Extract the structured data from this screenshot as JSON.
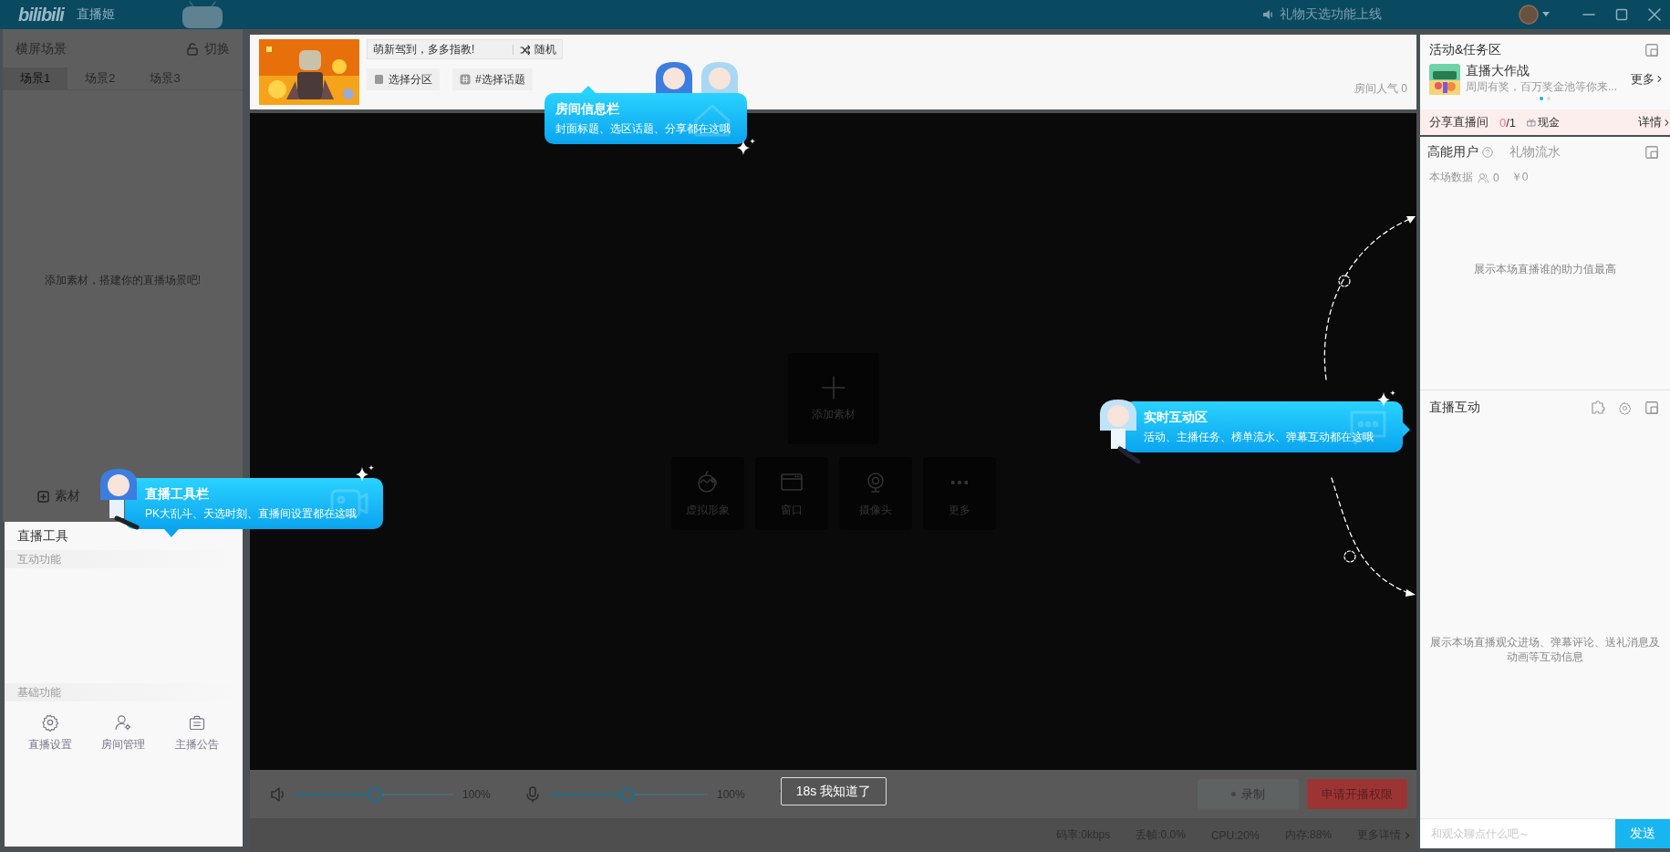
{
  "title_bar": {
    "logo": "bilibili",
    "app_name": "直播姬",
    "notice": "礼物天选功能上线"
  },
  "scene_panel": {
    "title": "横屏场景",
    "switch_button": "切换",
    "tabs": [
      {
        "label": "场景1",
        "selected": true
      },
      {
        "label": "场景2",
        "selected": false
      },
      {
        "label": "场景3",
        "selected": false
      }
    ],
    "empty_hint": "添加素材，搭建你的直播场景吧!",
    "add_button": "素材"
  },
  "tools_panel": {
    "title": "直播工具",
    "interactive_heading": "互动功能",
    "basic_heading": "基础功能",
    "basic_items": [
      {
        "kind": "settings",
        "label": "直播设置"
      },
      {
        "kind": "room",
        "label": "房间管理"
      },
      {
        "kind": "notice",
        "label": "主播公告"
      }
    ]
  },
  "room_bar": {
    "title_value": "萌新驾到，多多指教!",
    "random_button": "随机",
    "category_button": "选择分区",
    "topic_button": "#选择话题",
    "popularity": "房间人气 0"
  },
  "preview": {
    "add_tile": "添加素材",
    "sources": [
      {
        "kind": "avatar",
        "label": "虚拟形象"
      },
      {
        "kind": "window",
        "label": "窗口"
      },
      {
        "kind": "camera",
        "label": "摄像头"
      },
      {
        "kind": "more",
        "label": "更多"
      }
    ]
  },
  "controls": {
    "sliders": [
      {
        "kind": "speaker",
        "level": 0.5,
        "reading": "100%"
      },
      {
        "kind": "mic",
        "level": 0.49,
        "reading": "100%"
      }
    ],
    "record_button": "录制",
    "apply_button": "申请开播权限"
  },
  "status_bar": {
    "items": [
      "码率:0kbps",
      "丢帧:0.0%",
      "CPU:20%",
      "内存:88%"
    ],
    "details_link": "更多详情"
  },
  "activity_panel": {
    "title": "活动&任务区",
    "event_title": "直播大作战",
    "event_desc": "周周有奖，百万奖金池等你来...",
    "more_link": "更多",
    "carousel": [
      {
        "selected": true
      },
      {
        "selected": false
      }
    ],
    "share_label": "分享直播间",
    "share_done": "0",
    "share_total": "/1",
    "reward": "现金",
    "details_link": "详情"
  },
  "fans_panel": {
    "tabs": [
      {
        "label": "高能用户",
        "selected": true
      },
      {
        "label": "礼物流水",
        "selected": false
      }
    ],
    "stats_label": "本场数据",
    "viewers": "0",
    "revenue": "￥0",
    "empty_hint": "展示本场直播谁的助力值最高"
  },
  "interaction_panel": {
    "title": "直播互动",
    "empty_hint": "展示本场直播观众进场、弹幕评论、送礼消息及动画等互动信息",
    "chat_placeholder": "和观众聊点什么吧～",
    "send_button": "发送"
  },
  "guide": {
    "tips": [
      {
        "kind": "room",
        "title": "房间信息栏",
        "text": "封面标题、选区话题、分享都在这哦"
      },
      {
        "kind": "tools",
        "title": "直播工具栏",
        "text": "PK大乱斗、天选时刻、直播间设置都在这哦"
      },
      {
        "kind": "interaction",
        "title": "实时互动区",
        "text": "活动、主播任务、榜单流水、弹幕互动都在这哦"
      }
    ],
    "dismiss_button": "18s 我知道了"
  }
}
